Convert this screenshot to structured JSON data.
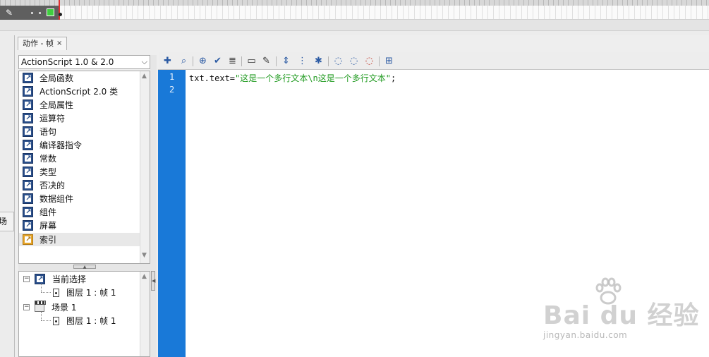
{
  "panel": {
    "tab_label": "动作 - 帧",
    "tab_close": "×"
  },
  "toolbox": {
    "version_select": "ActionScript 1.0 & 2.0",
    "items": [
      {
        "label": "全局函数"
      },
      {
        "label": "ActionScript 2.0 类"
      },
      {
        "label": "全局属性"
      },
      {
        "label": "运算符"
      },
      {
        "label": "语句"
      },
      {
        "label": "编译器指令"
      },
      {
        "label": "常数"
      },
      {
        "label": "类型"
      },
      {
        "label": "否决的"
      },
      {
        "label": "数据组件"
      },
      {
        "label": "组件"
      },
      {
        "label": "屏幕"
      },
      {
        "label": "索引",
        "color": "#e6a52a"
      }
    ]
  },
  "script_navigator": {
    "current_selection": "当前选择",
    "current_frame": "图层 1 : 帧 1",
    "scene": "场景 1",
    "scene_frame": "图层 1 : 帧 1"
  },
  "toolbar": {
    "icons": [
      "add-item-icon",
      "find-icon",
      "insert-target-path-icon",
      "check-syntax-icon",
      "auto-format-icon",
      "show-code-hint-icon",
      "debug-options-icon",
      "collapse-between-braces-icon",
      "collapse-selection-icon",
      "expand-all-icon",
      "apply-block-comment-icon",
      "apply-line-comment-icon",
      "remove-comment-icon",
      "show-hide-toolbox-icon"
    ]
  },
  "editor": {
    "line_numbers": [
      "1",
      "2"
    ],
    "code_prefix": "txt.text=",
    "code_string": "\"这是一个多行文本\\n这是一个多行文本\"",
    "code_suffix": ";",
    "string_color": "#1f9a1f",
    "gutter_color": "#1979d8"
  },
  "scene_panel": {
    "partial_label": "场景"
  },
  "watermark": {
    "logo": "Bai du 经验",
    "url": "jingyan.baidu.com"
  }
}
